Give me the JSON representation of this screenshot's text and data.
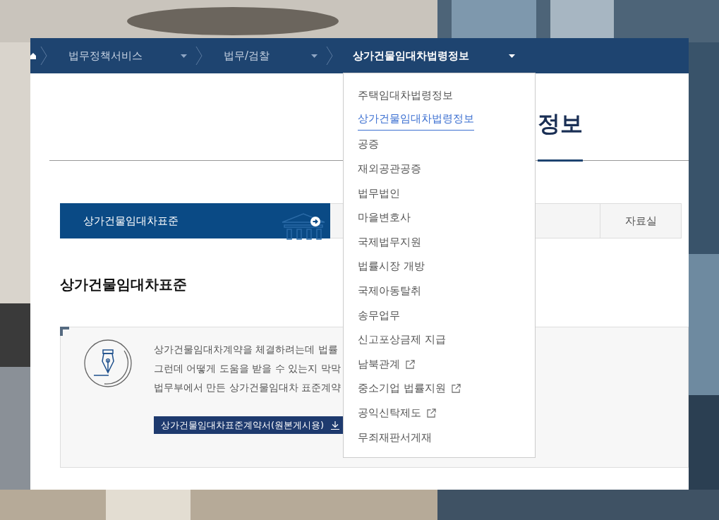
{
  "breadcrumb": [
    {
      "label": "법무정책서비스",
      "current": false
    },
    {
      "label": "법무/검찰",
      "current": false
    },
    {
      "label": "상가건물임대차법령정보",
      "current": true
    }
  ],
  "page_title": "정보",
  "tabs": [
    {
      "label": "상가건물임대차표준",
      "selected": true
    },
    {
      "selected": false
    },
    {
      "label": "자료실",
      "selected": false
    }
  ],
  "section_heading": "상가건물임대차표준",
  "info_box": {
    "lines": [
      "상가건물임대차계약을 체결하려는데 법률",
      "그런데 어떻게 도움을 받을 수 있는지 막막",
      "법무부에서 만든 상가건물임대차 표준계약"
    ],
    "download_button": "상가건물임대차표준계약서(원본게시용)"
  },
  "dropdown": [
    {
      "label": "주택임대차법령정보",
      "selected": false,
      "external": false
    },
    {
      "label": "상가건물임대차법령정보",
      "selected": true,
      "external": false
    },
    {
      "label": "공증",
      "selected": false,
      "external": false
    },
    {
      "label": "재외공관공증",
      "selected": false,
      "external": false
    },
    {
      "label": "법무법인",
      "selected": false,
      "external": false
    },
    {
      "label": "마을변호사",
      "selected": false,
      "external": false
    },
    {
      "label": "국제법무지원",
      "selected": false,
      "external": false
    },
    {
      "label": "법률시장 개방",
      "selected": false,
      "external": false
    },
    {
      "label": "국제아동탈취",
      "selected": false,
      "external": false
    },
    {
      "label": "송무업무",
      "selected": false,
      "external": false
    },
    {
      "label": "신고포상금제 지급",
      "selected": false,
      "external": false
    },
    {
      "label": "남북관계",
      "selected": false,
      "external": true
    },
    {
      "label": "중소기업 법률지원",
      "selected": false,
      "external": true
    },
    {
      "label": "공익신탁제도",
      "selected": false,
      "external": true
    },
    {
      "label": "무죄재판서게재",
      "selected": false,
      "external": false
    }
  ]
}
